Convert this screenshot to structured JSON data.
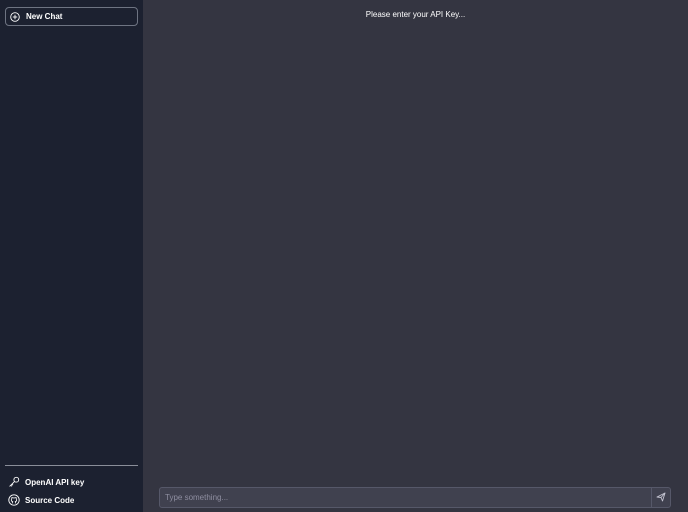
{
  "sidebar": {
    "new_chat_label": "New Chat",
    "links": [
      {
        "label": "OpenAI API key",
        "icon": "key-icon"
      },
      {
        "label": "Source Code",
        "icon": "github-icon"
      }
    ]
  },
  "main": {
    "notice": "Please enter your API Key...",
    "composer": {
      "placeholder": "Type something...",
      "value": "",
      "send_icon": "send-icon"
    }
  },
  "colors": {
    "sidebar_bg": "#1c2130",
    "main_bg": "#343541",
    "input_bg": "#40414f",
    "text": "#ffffff"
  }
}
